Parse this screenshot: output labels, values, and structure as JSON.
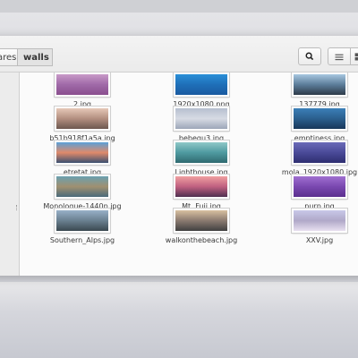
{
  "breadcrumb": {
    "parent": "ares",
    "current": "walls"
  },
  "toolbar": {
    "search_icon": "search-icon",
    "list_icon": "list-view-icon",
    "grid_icon": "grid-view-icon"
  },
  "files": [
    {
      "name": "2.jpg",
      "colors": [
        "#c89ac8",
        "#a06aa8",
        "#8a4e8e"
      ]
    },
    {
      "name": "1920x1080.png",
      "colors": [
        "#2a8fd8",
        "#1f6fb8",
        "#1a5aa0"
      ]
    },
    {
      "name": "137779.jpg",
      "colors": [
        "#a7c7e0",
        "#5c7d9a",
        "#2d3a48"
      ]
    },
    {
      "name": "b51b918f1a5a.jpg",
      "colors": [
        "#e6c8b8",
        "#b38f80",
        "#6d5850"
      ]
    },
    {
      "name": "bebequ3.jpg",
      "colors": [
        "#b6bfcf",
        "#d7dbe4",
        "#9ca6b8"
      ]
    },
    {
      "name": "emptiness.jpg",
      "colors": [
        "#3b7fb8",
        "#2b5f8e",
        "#18375a"
      ]
    },
    {
      "name": "etretat.jpg",
      "colors": [
        "#5aa0d8",
        "#e08a6a",
        "#3a5070"
      ]
    },
    {
      "name": "Lighthouse.jpg",
      "colors": [
        "#8fc8c8",
        "#4f9aa0",
        "#2f6a70"
      ]
    },
    {
      "name": "mola_1920x1080.jpg",
      "colors": [
        "#6a6ab8",
        "#4a4a98",
        "#2e2e70"
      ]
    },
    {
      "name": "Monologue-1440p.jpg",
      "colors": [
        "#6aa0b0",
        "#a09070",
        "#4a6a7a"
      ]
    },
    {
      "name": "Mt. Fuji.jpg",
      "colors": [
        "#f0a0a0",
        "#c06080",
        "#503050"
      ]
    },
    {
      "name": "purp.jpg",
      "colors": [
        "#a070d0",
        "#7a48b0",
        "#5a2e8e"
      ]
    },
    {
      "name": "Southern_Alps.jpg",
      "colors": [
        "#98b0c8",
        "#6a8090",
        "#3a4850"
      ]
    },
    {
      "name": "walkonthebeach.jpg",
      "colors": [
        "#d8c0a0",
        "#8a7a70",
        "#404040"
      ]
    },
    {
      "name": "XXV.jpg",
      "colors": [
        "#c8c8e8",
        "#b0a8c8",
        "#e8e0f0"
      ]
    }
  ]
}
